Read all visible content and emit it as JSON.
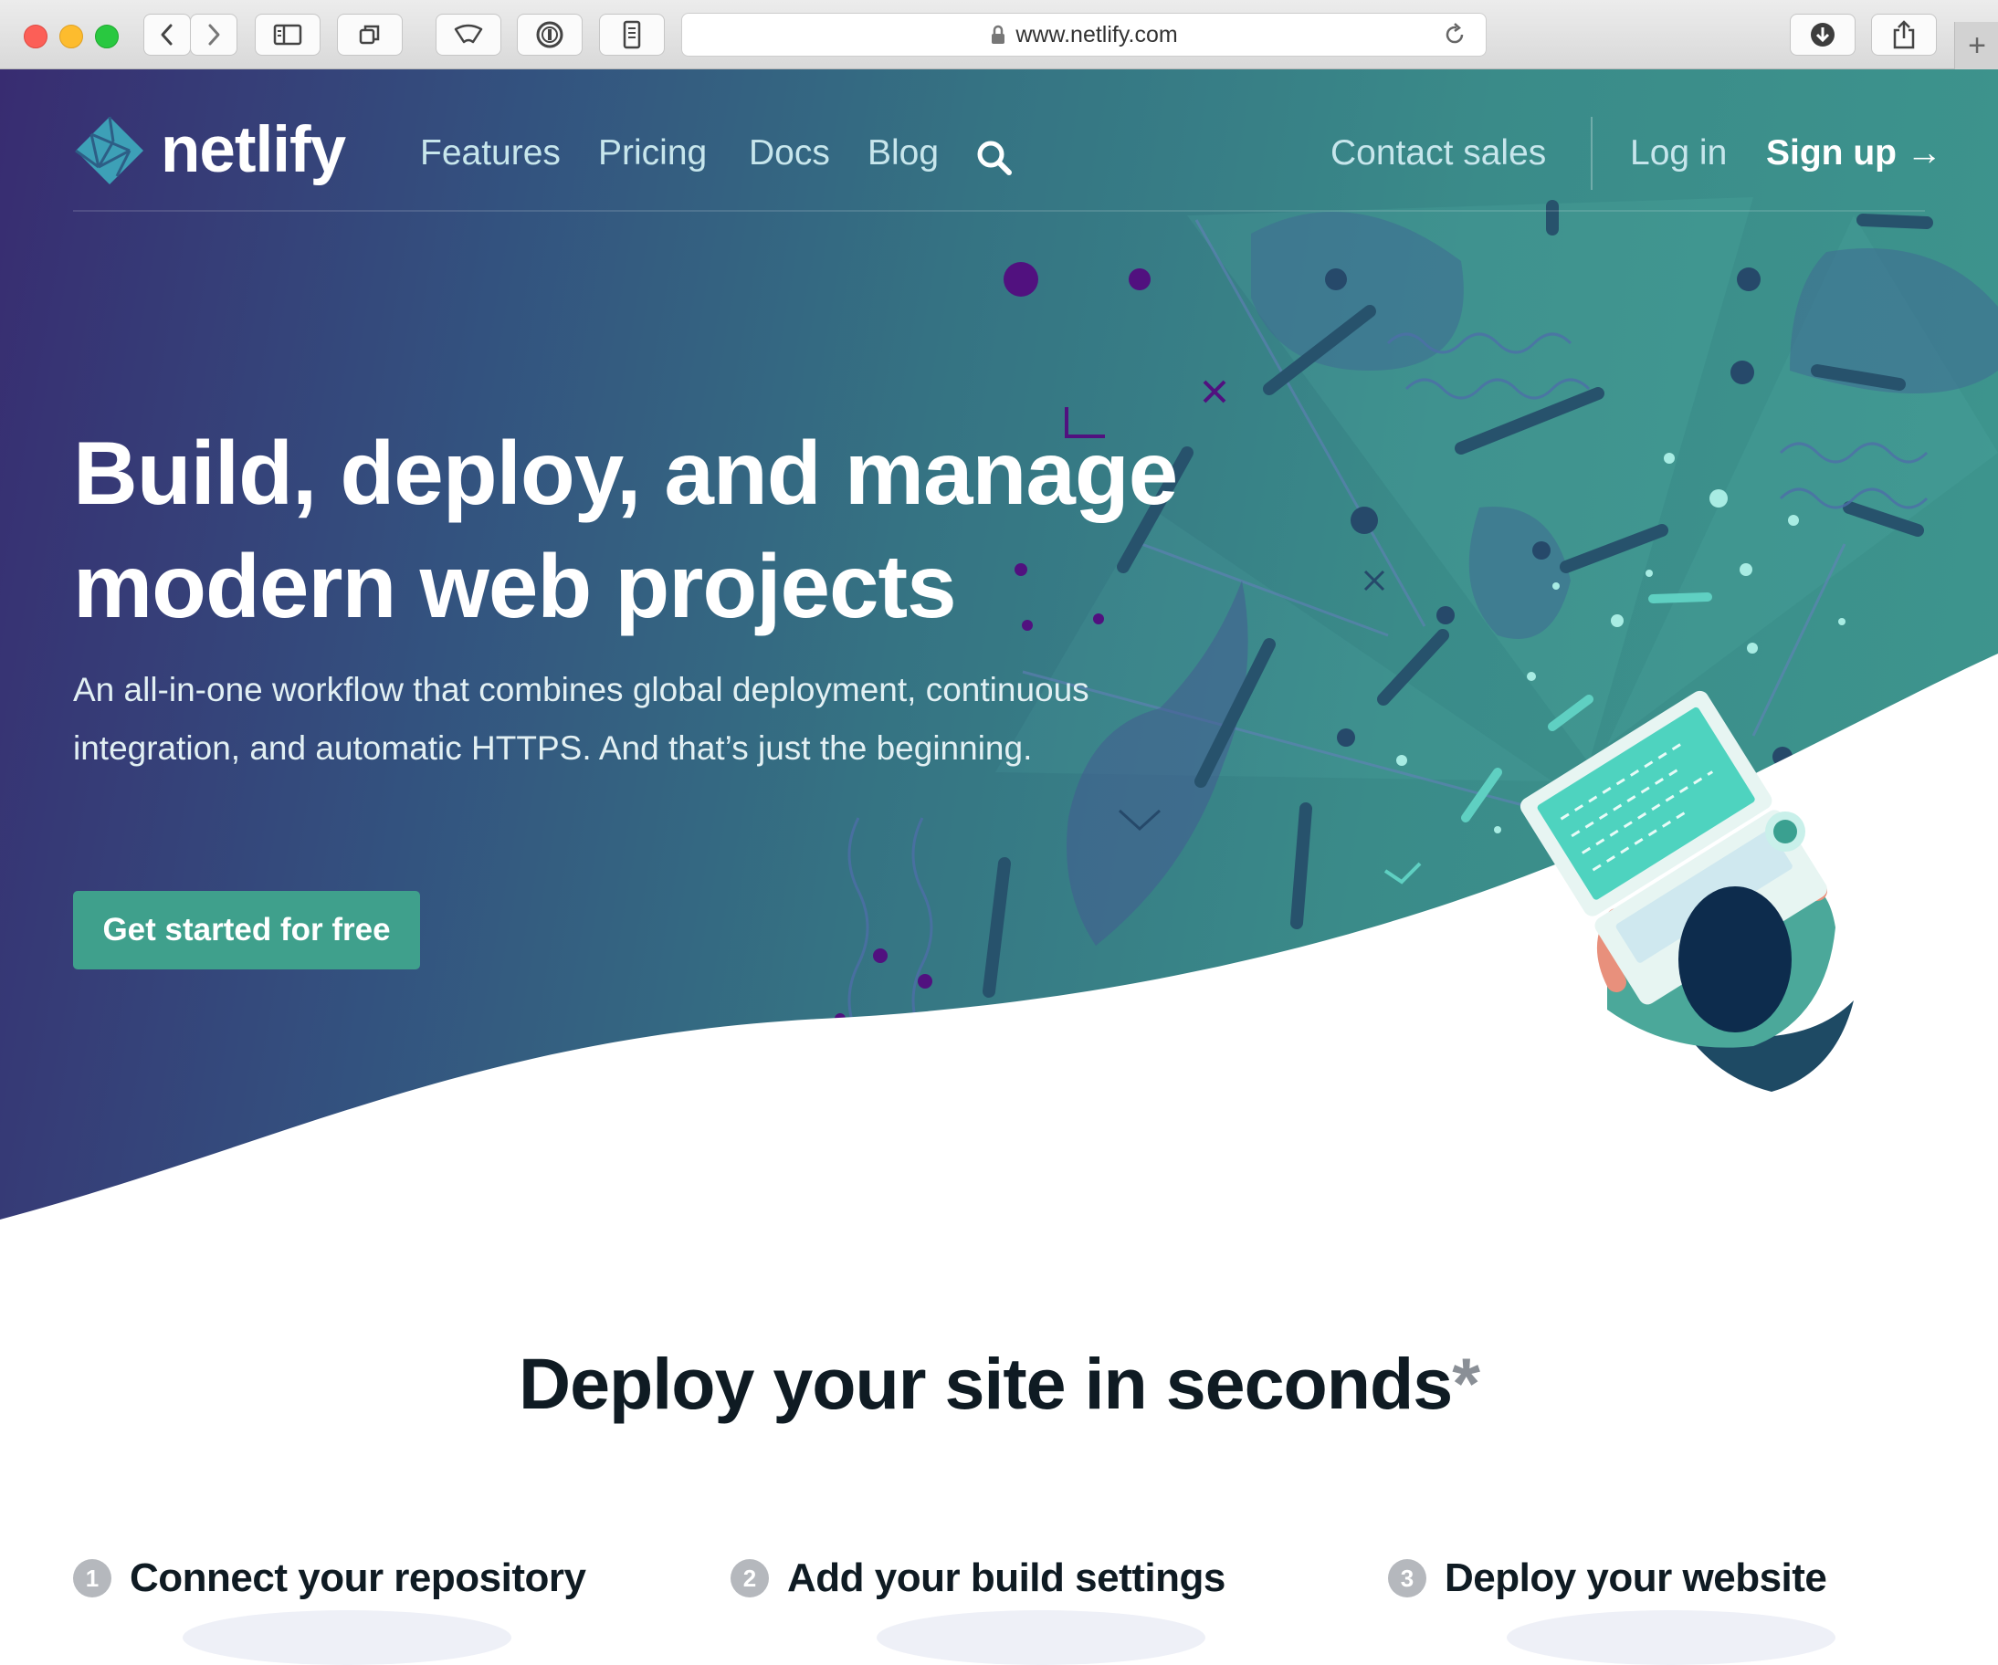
{
  "browser": {
    "url": "www.netlify.com",
    "new_tab_label": "+"
  },
  "nav": {
    "logo_text": "netlify",
    "links": [
      "Features",
      "Pricing",
      "Docs",
      "Blog"
    ],
    "contact_sales": "Contact sales",
    "log_in": "Log in",
    "sign_up": "Sign up →"
  },
  "hero": {
    "title": "Build, deploy, and manage modern web projects",
    "subtitle": "An all-in-one workflow that combines global deployment, continuous integration, and automatic HTTPS. And that’s just the beginning.",
    "cta_label": "Get started for free"
  },
  "deploy": {
    "title": "Deploy your site in seconds",
    "asterisk": "*",
    "steps": [
      {
        "number": "1",
        "label": "Connect your repository"
      },
      {
        "number": "2",
        "label": "Add your build settings"
      },
      {
        "number": "3",
        "label": "Deploy your website"
      }
    ]
  },
  "colors": {
    "hero_gradient_start": "#382c71",
    "hero_gradient_end": "#3e968e",
    "accent_teal": "#3fa08c",
    "text_dark": "#0f1b23"
  },
  "icons": [
    "back-icon",
    "forward-icon",
    "sidebar-icon",
    "tabs-icon",
    "readinglist-icon",
    "password-icon",
    "extension-icon",
    "lock-icon",
    "reload-icon",
    "download-icon",
    "share-icon",
    "netlify-logo-icon",
    "search-icon"
  ]
}
